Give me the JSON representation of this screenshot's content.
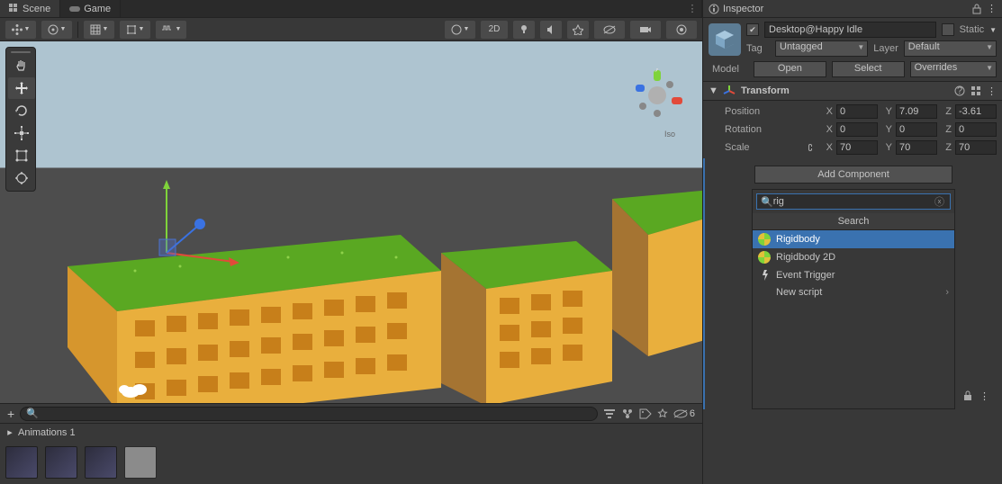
{
  "tabs": {
    "scene": "Scene",
    "game": "Game"
  },
  "inspector": {
    "title": "Inspector",
    "static_label": "Static",
    "object_name": "Desktop@Happy Idle",
    "tag_label": "Tag",
    "tag_value": "Untagged",
    "layer_label": "Layer",
    "layer_value": "Default",
    "model_label": "Model",
    "open_btn": "Open",
    "select_btn": "Select",
    "overrides_btn": "Overrides"
  },
  "transform": {
    "title": "Transform",
    "position_label": "Position",
    "rotation_label": "Rotation",
    "scale_label": "Scale",
    "pos": {
      "x": "0",
      "y": "7.09",
      "z": "-3.61"
    },
    "rot": {
      "x": "0",
      "y": "0",
      "z": "0"
    },
    "scale": {
      "x": "70",
      "y": "70",
      "z": "70"
    }
  },
  "add_component": {
    "button": "Add Component",
    "search_value": "rig",
    "header": "Search",
    "items": [
      {
        "label": "Rigidbody",
        "icon": "physics"
      },
      {
        "label": "Rigidbody 2D",
        "icon": "physics"
      },
      {
        "label": "Event Trigger",
        "icon": "event"
      },
      {
        "label": "New script",
        "icon": "none",
        "chevron": true
      }
    ]
  },
  "mid_strip": {
    "visible_count": "6"
  },
  "animations": {
    "title": "Animations 1"
  },
  "viewport": {
    "iso_label": "Iso"
  }
}
